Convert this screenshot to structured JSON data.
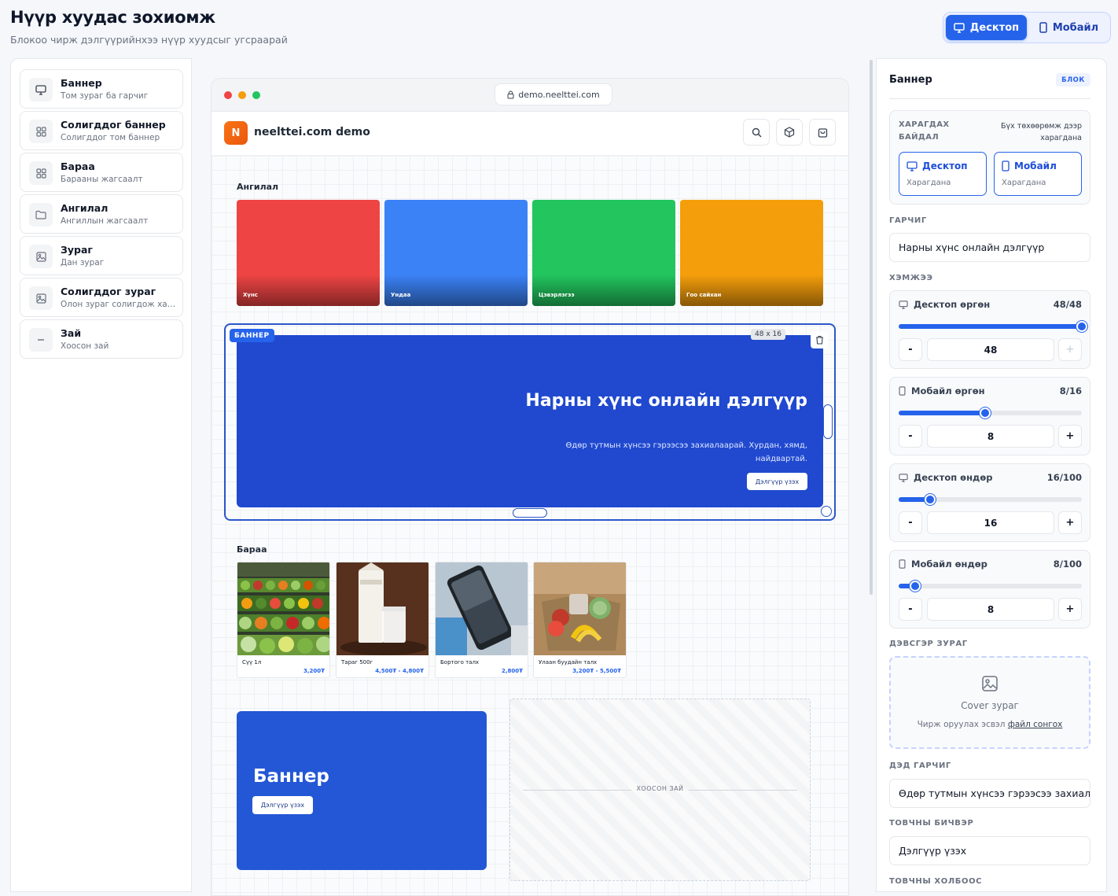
{
  "header": {
    "title": "Нүүр хуудас зохиомж",
    "subtitle": "Блокоо чирж дэлгүүрийнхээ нүүр хуудсыг угсраарай",
    "view_desktop": "Десктоп",
    "view_mobile": "Мобайл"
  },
  "sidebar": {
    "items": [
      {
        "title": "Баннер",
        "desc": "Том зураг ба гарчиг",
        "icon": "monitor-icon"
      },
      {
        "title": "Солигддог баннер",
        "desc": "Солигддог том баннер",
        "icon": "grid-icon"
      },
      {
        "title": "Бараа",
        "desc": "Барааны жагсаалт",
        "icon": "grid-icon"
      },
      {
        "title": "Ангилал",
        "desc": "Ангиллын жагсаалт",
        "icon": "folder-icon"
      },
      {
        "title": "Зураг",
        "desc": "Дан зураг",
        "icon": "image-icon"
      },
      {
        "title": "Солигддог зураг",
        "desc": "Олон зураг солигдож харагдана",
        "icon": "image-icon"
      },
      {
        "title": "Зай",
        "desc": "Хоосон зай",
        "icon": "minus-icon"
      }
    ]
  },
  "preview": {
    "url": "demo.neelttei.com",
    "logo_letter": "N",
    "site_name": "neelttei.com demo",
    "categories_label": "Ангилал",
    "categories": [
      {
        "name": "Хүнс",
        "color": "#ef4444"
      },
      {
        "name": "Ундаа",
        "color": "#3b82f6"
      },
      {
        "name": "Цэвэрлэгээ",
        "color": "#22c55e"
      },
      {
        "name": "Гоо сайхан",
        "color": "#f59e0b"
      }
    ],
    "banner": {
      "tag": "БАННЕР",
      "size": "48 x 16",
      "title": "Нарны хүнс онлайн дэлгүүр",
      "subtitle": "Өдөр тутмын хүнсээ гэрээсээ захиалаарай. Хурдан, хямд, найдвартай.",
      "button": "Дэлгүүр үзэх"
    },
    "products_label": "Бараа",
    "products": [
      {
        "name": "Сүү 1л",
        "price": "3,200₮"
      },
      {
        "name": "Тараг 500г",
        "price": "4,500₮ - 4,800₮"
      },
      {
        "name": "Бортого талх",
        "price": "2,800₮"
      },
      {
        "name": "Улаан буудайн талх",
        "price": "3,200₮ - 5,500₮"
      }
    ],
    "small_banner": {
      "title": "Баннер",
      "button": "Дэлгүүр үзэх"
    },
    "spacer_label": "ХООСОН ЗАЙ"
  },
  "panel": {
    "title": "Баннер",
    "badge": "БЛОК",
    "visibility_label": "ХАРАГДАХ БАЙДАЛ",
    "visibility_note": "Бүх төхөөрөмж дээр харагдана",
    "vis_desktop": "Десктоп",
    "vis_mobile": "Мобайл",
    "vis_state": "Харагдана",
    "title_label": "ГАРЧИГ",
    "title_value": "Нарны хүнс онлайн дэлгүүр",
    "size_label": "ХЭМЖЭЭ",
    "sizes": [
      {
        "label": "Десктоп өргөн",
        "display": "48/48",
        "value": "48",
        "ratio": 1.0,
        "icon": "monitor-icon",
        "plus_disabled": true
      },
      {
        "label": "Мобайл өргөн",
        "display": "8/16",
        "value": "8",
        "ratio": 0.47,
        "icon": "phone-icon",
        "plus_disabled": false
      },
      {
        "label": "Десктоп өндөр",
        "display": "16/100",
        "value": "16",
        "ratio": 0.17,
        "icon": "monitor-icon",
        "plus_disabled": false
      },
      {
        "label": "Мобайл өндөр",
        "display": "8/100",
        "value": "8",
        "ratio": 0.09,
        "icon": "phone-icon",
        "plus_disabled": false
      }
    ],
    "bg_label": "ДЭВСГЭР ЗУРАГ",
    "upload_title": "Cover зураг",
    "upload_hint": "Чирж оруулах эсвэл",
    "upload_link": "файл сонгох",
    "subtitle_label": "ДЭД ГАРЧИГ",
    "subtitle_value": "Өдөр тутмын хүнсээ гэрээсээ захиалаарай. Хурдан, хямд, найдвартай.",
    "button_label": "ТОВЧНЫ БИЧВЭР",
    "button_value": "Дэлгүүр үзэх",
    "link_label": "ТОВЧНЫ ХОЛБООС"
  }
}
